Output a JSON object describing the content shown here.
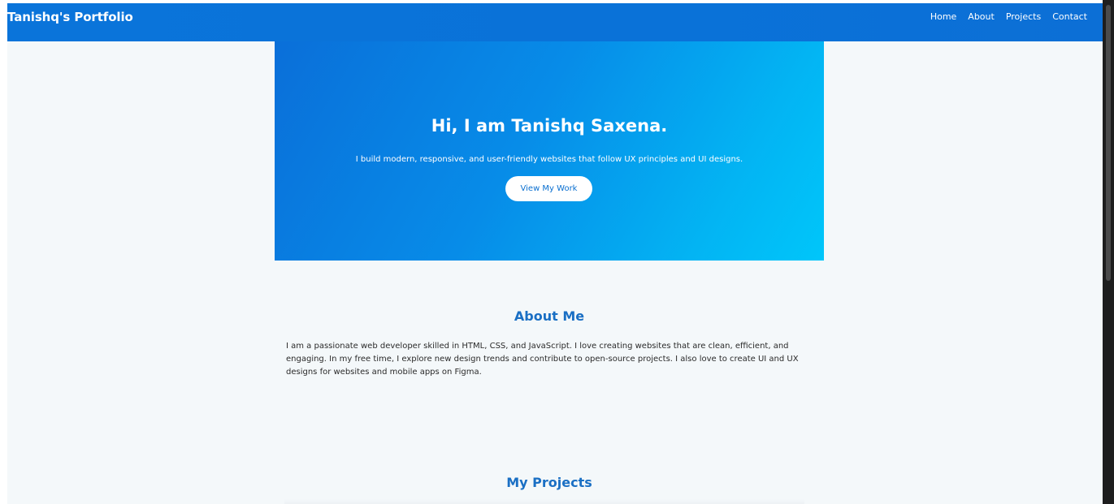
{
  "navbar": {
    "brand": "Tanishq's Portfolio",
    "links": [
      "Home",
      "About",
      "Projects",
      "Contact"
    ],
    "background": "#0a74da"
  },
  "hero": {
    "title": "Hi, I am Tanishq Saxena.",
    "subtitle": "I build modern, responsive, and user-friendly websites that follow UX principles and UI designs.",
    "cta_label": "View My Work",
    "gradient_start": "#0a6fd9",
    "gradient_end": "#00c6fa"
  },
  "about": {
    "title": "About Me",
    "body": "I am a passionate web developer skilled in HTML, CSS, and JavaScript. I love creating websites that are clean, efficient, and engaging. In my free time, I explore new design trends and contribute to open-source projects. I also love to create UI and UX designs for websites and mobile apps on Figma."
  },
  "projects": {
    "title": "My Projects"
  },
  "colors": {
    "accent": "#1a6fc4",
    "page_background": "#f4f8fa"
  }
}
